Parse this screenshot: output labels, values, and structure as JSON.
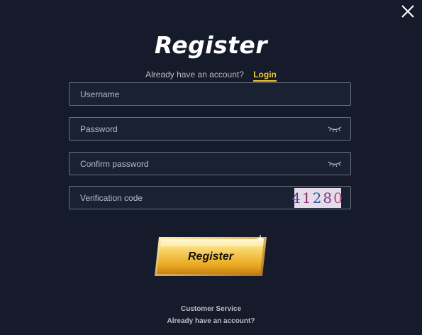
{
  "title": "Register",
  "account_prompt": "Already have an account?",
  "login_link": "Login",
  "fields": {
    "username": "Username",
    "password": "Password",
    "confirm_password": "Confirm password",
    "verification_code": "Verification code"
  },
  "captcha": [
    "4",
    "1",
    "2",
    "8",
    "0"
  ],
  "register_button": "Register",
  "footer": {
    "customer_service": "Customer Service",
    "have_account": "Already have an account?"
  },
  "icons": {
    "close": "close-icon",
    "password_toggle": "eye-closed-icon"
  },
  "colors": {
    "background": "#151b2b",
    "accent": "#f0c830",
    "button_gold": "#f2c040"
  }
}
